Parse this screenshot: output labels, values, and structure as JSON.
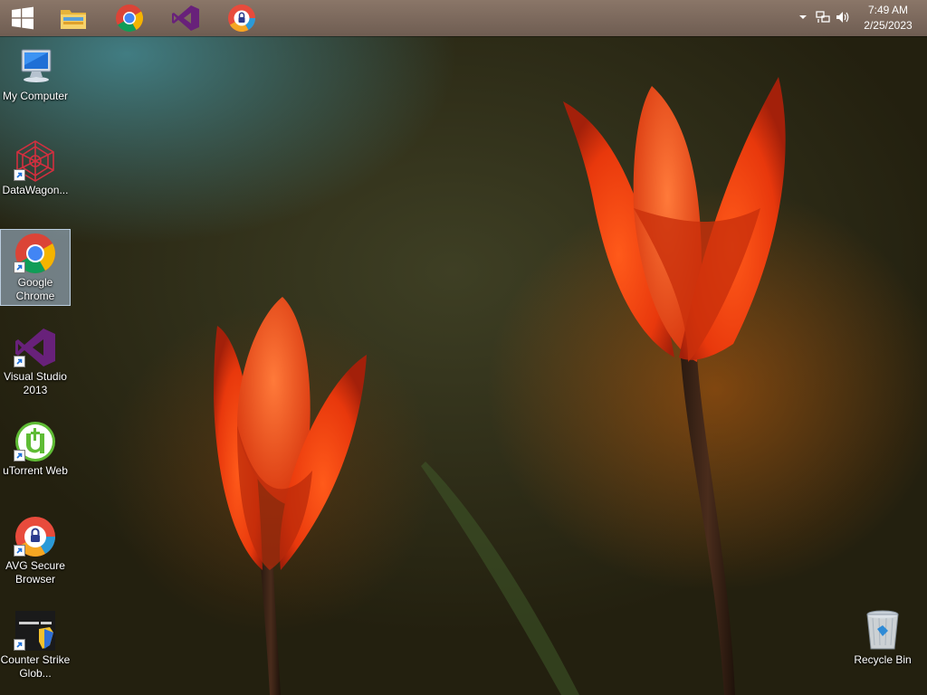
{
  "taskbar": {
    "pinned": [
      {
        "name": "start-button",
        "icon": "windows-logo-icon"
      },
      {
        "name": "file-explorer",
        "icon": "folder-icon"
      },
      {
        "name": "google-chrome",
        "icon": "chrome-icon"
      },
      {
        "name": "visual-studio",
        "icon": "visual-studio-icon"
      },
      {
        "name": "avg-secure-browser",
        "icon": "avg-browser-icon"
      }
    ],
    "tray": {
      "icons": [
        "show-hidden-icons-arrow-icon",
        "network-icon",
        "volume-icon"
      ],
      "time": "7:49 AM",
      "date": "2/25/2023"
    }
  },
  "desktop": {
    "icons": [
      {
        "label": "My Computer",
        "icon": "computer-icon",
        "shortcut": false,
        "selected": false
      },
      {
        "label": "DataWagon...",
        "icon": "datawagon-icon",
        "shortcut": true,
        "selected": false
      },
      {
        "label": "Google Chrome",
        "icon": "chrome-icon",
        "shortcut": true,
        "selected": true
      },
      {
        "label": "Visual Studio 2013",
        "icon": "visual-studio-icon",
        "shortcut": true,
        "selected": false
      },
      {
        "label": "uTorrent Web",
        "icon": "utorrent-icon",
        "shortcut": true,
        "selected": false
      },
      {
        "label": "AVG Secure Browser",
        "icon": "avg-browser-icon",
        "shortcut": true,
        "selected": false
      },
      {
        "label": "Counter Strike Glob...",
        "icon": "counter-strike-icon",
        "shortcut": true,
        "selected": false
      }
    ],
    "recycle_bin": {
      "label": "Recycle Bin",
      "icon": "recycle-bin-icon"
    }
  },
  "colors": {
    "taskbar": "#7d6a5e",
    "selection": "#afc8e1",
    "tulip": "#ff4a12",
    "vs_purple": "#68217a",
    "utorrent_green": "#5fbc35"
  }
}
